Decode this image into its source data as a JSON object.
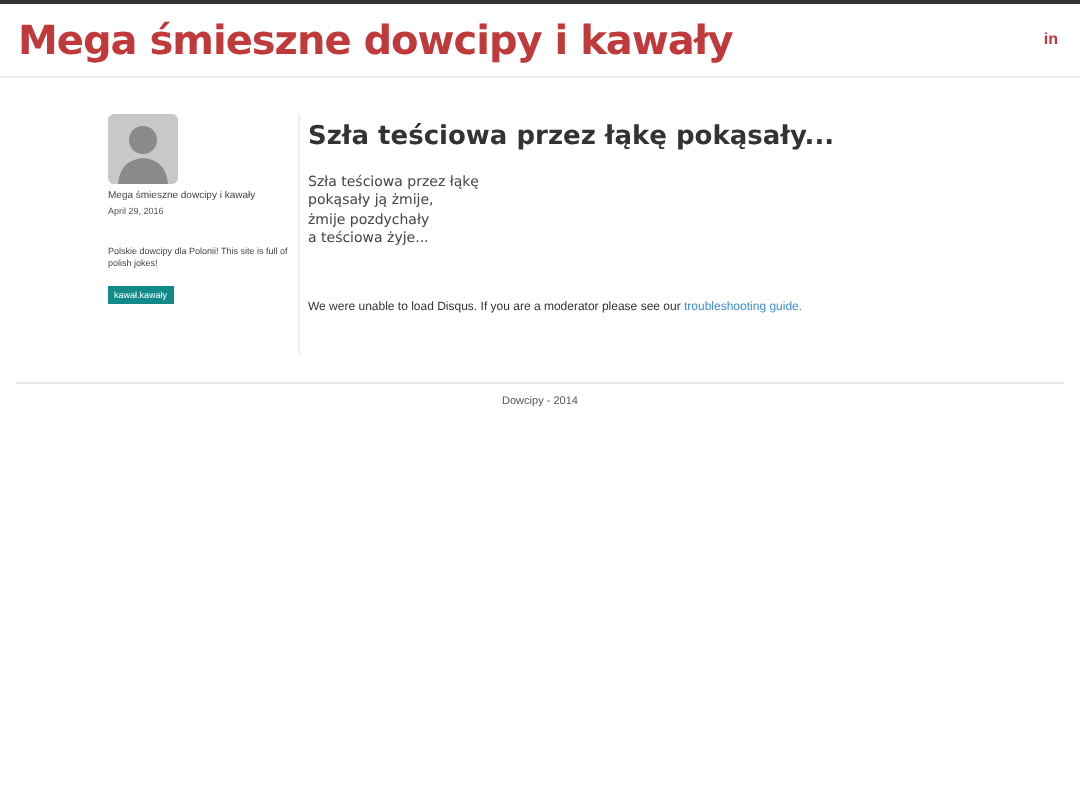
{
  "header": {
    "title": "Mega śmieszne dowcipy i kawały",
    "social_icon": "in"
  },
  "author": {
    "name": "Mega śmieszne dowcipy i kawały",
    "date": "April 29, 2016",
    "bio": "Polskie dowcipy dla Polonii! This site is full of polish jokes!",
    "tag": "kawał.kawały"
  },
  "post": {
    "title": "Szła teściowa przez łąkę pokąsały...",
    "lines": [
      "Szła teściowa przez łąkę",
      "pokąsały ją żmije,",
      "żmije pozdychały",
      "a teściowa żyje..."
    ]
  },
  "comments": {
    "message": "We were unable to load Disqus. If you are a moderator please see our",
    "link": "troubleshooting guide."
  },
  "footer": {
    "text": "Dowcipy - 2014"
  }
}
